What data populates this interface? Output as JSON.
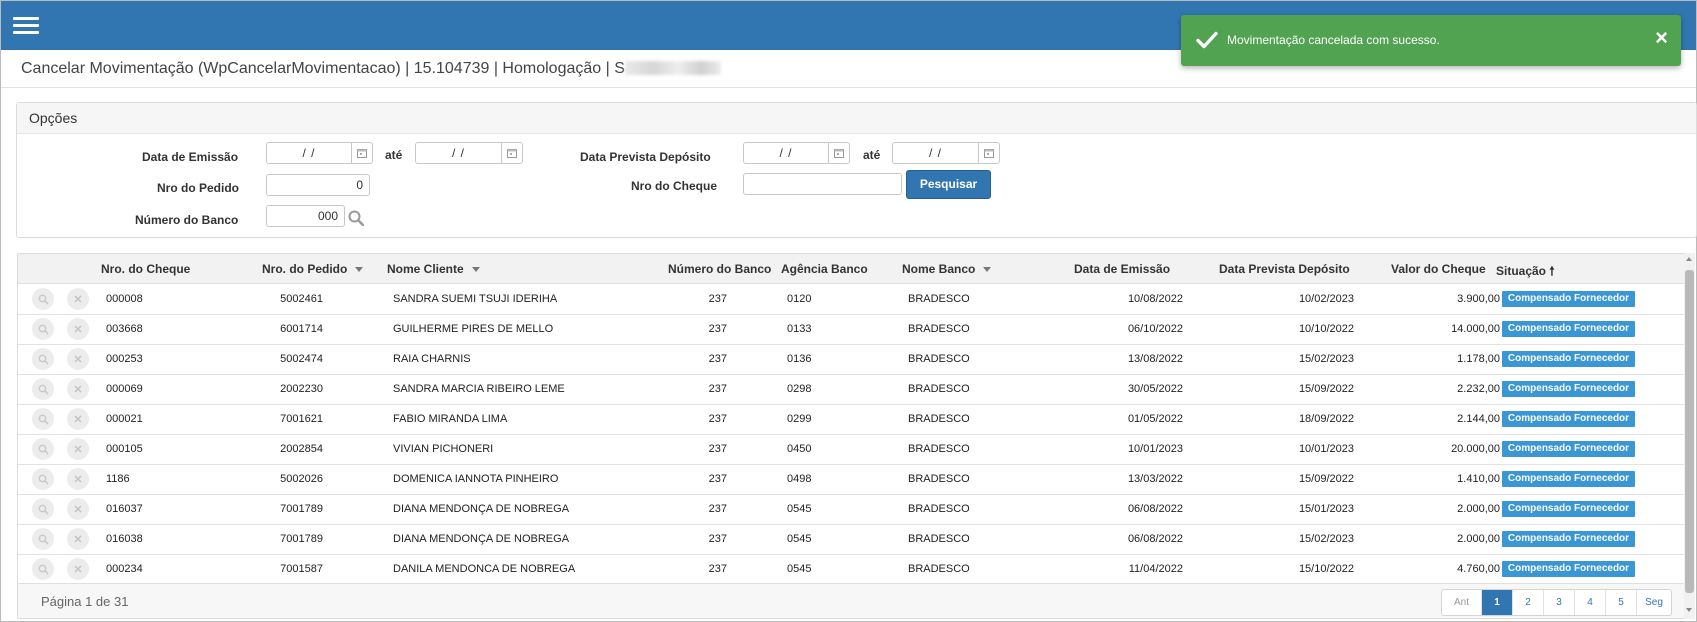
{
  "header": {
    "title": "Cancelar Movimentação (WpCancelarMovimentacao) | 15.104739 | Homologação | S"
  },
  "toast": {
    "message": "Movimentação cancelada com sucesso.",
    "close": "×",
    "color": "#51a351"
  },
  "options": {
    "heading": "Opções",
    "data_emissao_label": "Data de Emissão",
    "ate_label": "até",
    "data_prevista_label": "Data Prevista Depósito",
    "nro_pedido_label": "Nro do Pedido",
    "nro_cheque_label": "Nro do Cheque",
    "numero_banco_label": "Número do Banco",
    "date_placeholder": " / / ",
    "nro_pedido_value": "0",
    "nro_cheque_value": "",
    "numero_banco_value": "000",
    "search_button": "Pesquisar"
  },
  "grid": {
    "columns": [
      "Nro. do Cheque",
      "Nro. do Pedido",
      "Nome Cliente",
      "Número do Banco",
      "Agência Banco",
      "Nome Banco",
      "Data de Emissão",
      "Data Prevista Depósito",
      "Valor do Cheque",
      "Situação"
    ],
    "sort_up_glyph": "🠕",
    "rows": [
      {
        "cheque": "000008",
        "pedido": "5002461",
        "cliente": "SANDRA SUEMI TSUJI IDERIHA",
        "banco": "237",
        "agencia": "0120",
        "nome_banco": "BRADESCO",
        "emissao": "10/08/2022",
        "prevista": "10/02/2023",
        "valor": "3.900,00",
        "situacao": "Compensado Fornecedor"
      },
      {
        "cheque": "003668",
        "pedido": "6001714",
        "cliente": "GUILHERME PIRES DE MELLO",
        "banco": "237",
        "agencia": "0133",
        "nome_banco": "BRADESCO",
        "emissao": "06/10/2022",
        "prevista": "10/10/2022",
        "valor": "14.000,00",
        "situacao": "Compensado Fornecedor"
      },
      {
        "cheque": "000253",
        "pedido": "5002474",
        "cliente": "RAIA CHARNIS",
        "banco": "237",
        "agencia": "0136",
        "nome_banco": "BRADESCO",
        "emissao": "13/08/2022",
        "prevista": "15/02/2023",
        "valor": "1.178,00",
        "situacao": "Compensado Fornecedor"
      },
      {
        "cheque": "000069",
        "pedido": "2002230",
        "cliente": "SANDRA MARCIA RIBEIRO LEME",
        "banco": "237",
        "agencia": "0298",
        "nome_banco": "BRADESCO",
        "emissao": "30/05/2022",
        "prevista": "15/09/2022",
        "valor": "2.232,00",
        "situacao": "Compensado Fornecedor"
      },
      {
        "cheque": "000021",
        "pedido": "7001621",
        "cliente": "FABIO MIRANDA LIMA",
        "banco": "237",
        "agencia": "0299",
        "nome_banco": "BRADESCO",
        "emissao": "01/05/2022",
        "prevista": "18/09/2022",
        "valor": "2.144,00",
        "situacao": "Compensado Fornecedor"
      },
      {
        "cheque": "000105",
        "pedido": "2002854",
        "cliente": "VIVIAN PICHONERI",
        "banco": "237",
        "agencia": "0450",
        "nome_banco": "BRADESCO",
        "emissao": "10/01/2023",
        "prevista": "10/01/2023",
        "valor": "20.000,00",
        "situacao": "Compensado Fornecedor"
      },
      {
        "cheque": "1186",
        "pedido": "5002026",
        "cliente": "DOMENICA IANNOTA PINHEIRO",
        "banco": "237",
        "agencia": "0498",
        "nome_banco": "BRADESCO",
        "emissao": "13/03/2022",
        "prevista": "15/09/2022",
        "valor": "1.410,00",
        "situacao": "Compensado Fornecedor"
      },
      {
        "cheque": "016037",
        "pedido": "7001789",
        "cliente": "DIANA MENDONÇA DE NOBREGA",
        "banco": "237",
        "agencia": "0545",
        "nome_banco": "BRADESCO",
        "emissao": "06/08/2022",
        "prevista": "15/01/2023",
        "valor": "2.000,00",
        "situacao": "Compensado Fornecedor"
      },
      {
        "cheque": "016038",
        "pedido": "7001789",
        "cliente": "DIANA MENDONÇA DE NOBREGA",
        "banco": "237",
        "agencia": "0545",
        "nome_banco": "BRADESCO",
        "emissao": "06/08/2022",
        "prevista": "15/02/2023",
        "valor": "2.000,00",
        "situacao": "Compensado Fornecedor"
      },
      {
        "cheque": "000234",
        "pedido": "7001587",
        "cliente": "DANILA MENDONCA DE NOBREGA",
        "banco": "237",
        "agencia": "0545",
        "nome_banco": "BRADESCO",
        "emissao": "11/04/2022",
        "prevista": "15/10/2022",
        "valor": "4.760,00",
        "situacao": "Compensado Fornecedor"
      }
    ]
  },
  "pagination": {
    "info": "Página 1 de 31",
    "prev": "Ant",
    "pages": [
      "1",
      "2",
      "3",
      "4",
      "5"
    ],
    "next": "Seg",
    "current": "1"
  },
  "colors": {
    "topbar": "#3276b1",
    "badge": "#3a97d4",
    "toast": "#51a351"
  }
}
